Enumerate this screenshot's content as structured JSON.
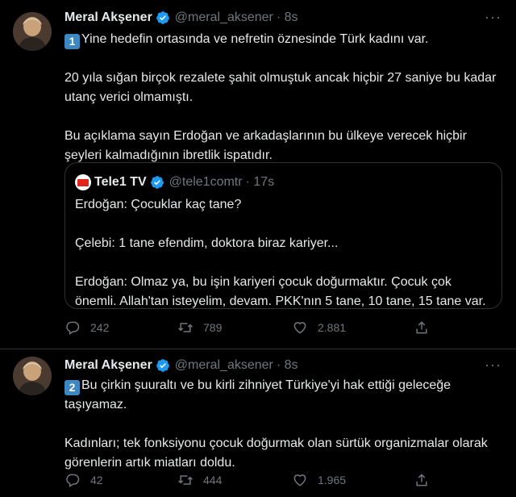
{
  "tweets": [
    {
      "name": "Meral Akşener",
      "handle": "@meral_aksener",
      "time": "· 8s",
      "number": "1",
      "paragraphs": [
        "Yine hedefin ortasında ve nefretin öznesinde Türk kadını var.",
        "20 yıla sığan birçok rezalete şahit olmuştuk ancak hiçbir 27 saniye bu kadar utanç verici olmamıştı.",
        "Bu açıklama sayın Erdoğan ve arkadaşlarının bu ülkeye verecek hiçbir şeyleri kalmadığının ibretlik ispatıdır."
      ],
      "quote": {
        "name": "Tele1 TV",
        "handle": "@tele1comtr",
        "time": "· 17s",
        "paragraphs": [
          "Erdoğan: Çocuklar kaç tane?",
          "Çelebi: 1 tane efendim, doktora biraz kariyer...",
          "Erdoğan: Olmaz ya, bu işin kariyeri çocuk doğurmaktır. Çocuk çok önemli. Allah'tan isteyelim, devam. PKK'nın 5 tane, 10 tane, 15 tane var."
        ]
      },
      "replies": "242",
      "retweets": "789",
      "likes": "2.881"
    },
    {
      "name": "Meral Akşener",
      "handle": "@meral_aksener",
      "time": "· 8s",
      "number": "2",
      "paragraphs": [
        "Bu çirkin şuuraltı ve bu kirli zihniyet Türkiye'yi hak ettiği geleceğe taşıyamaz.",
        "Kadınları; tek fonksiyonu çocuk doğurmak olan sürtük organizmalar olarak görenlerin artık miatları doldu."
      ],
      "replies": "42",
      "retweets": "444",
      "likes": "1.965"
    }
  ],
  "icons": {
    "verified": "verified-badge-icon",
    "more": "more-icon",
    "reply": "reply-icon",
    "retweet": "retweet-icon",
    "like": "heart-icon",
    "share": "share-icon"
  },
  "colors": {
    "background": "#000000",
    "text": "#e7e9ea",
    "secondary": "#71767b",
    "border": "#2f3336",
    "verified": "#1d9bf0",
    "keycap": "#3b88c3"
  }
}
